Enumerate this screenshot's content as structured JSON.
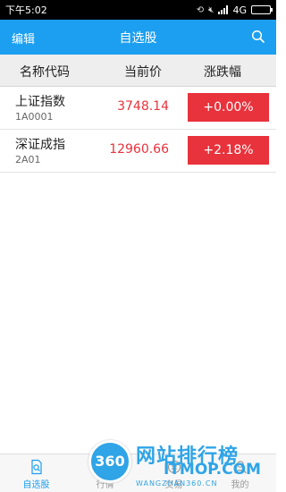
{
  "status_bar": {
    "time": "下午5:02",
    "network": "4G"
  },
  "header": {
    "edit_label": "编辑",
    "title": "自选股",
    "accent_color": "#1c9ff0"
  },
  "columns": {
    "name": "名称代码",
    "price": "当前价",
    "change": "涨跌幅"
  },
  "stocks": [
    {
      "name": "上证指数",
      "code": "1A0001",
      "price": "3748.14",
      "change": "+0.00%"
    },
    {
      "name": "深证成指",
      "code": "2A01",
      "price": "12960.66",
      "change": "+2.18%"
    }
  ],
  "tabs": [
    {
      "label": "自选股",
      "active": true
    },
    {
      "label": "行情"
    },
    {
      "label": "交易"
    },
    {
      "label": "我的"
    }
  ],
  "watermark": {
    "badge": "360",
    "text": "网站排行榜",
    "domain": "ITMOP.COM",
    "sub": "WANGZHAN360.CN"
  },
  "colors": {
    "up": "#e8323c",
    "tab_inactive": "#999999"
  }
}
